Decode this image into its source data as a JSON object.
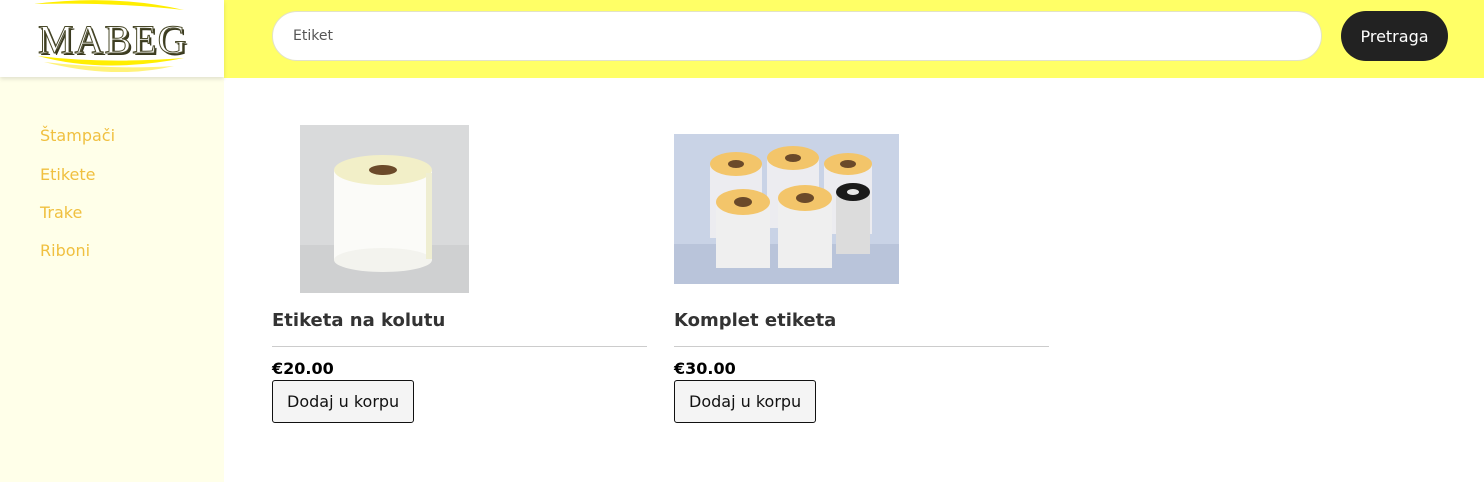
{
  "brand": {
    "logo_text": "MABEG"
  },
  "search": {
    "value": "Etiket",
    "button_label": "Pretraga"
  },
  "sidebar": {
    "items": [
      {
        "label": "Štampači"
      },
      {
        "label": "Etikete"
      },
      {
        "label": "Trake"
      },
      {
        "label": "Riboni"
      }
    ]
  },
  "products": [
    {
      "title": "Etiketa na kolutu",
      "price": "€20.00",
      "button_label": "Dodaj u korpu"
    },
    {
      "title": "Komplet etiketa",
      "price": "€30.00",
      "button_label": "Dodaj u korpu"
    }
  ],
  "colors": {
    "header_bg": "#ffff66",
    "sidebar_bg": "#ffffe9",
    "sidebar_link": "#f0c040",
    "search_button_bg": "#222222"
  }
}
